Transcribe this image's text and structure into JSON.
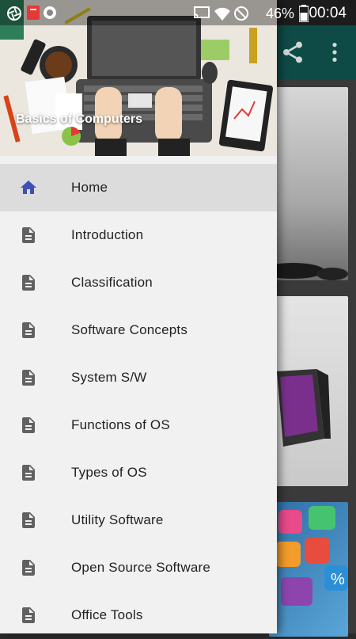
{
  "status_bar": {
    "battery_percent": "46%",
    "time": "00:04"
  },
  "drawer": {
    "header_title": "Basics of Computers",
    "items": [
      {
        "label": "Home",
        "icon": "home-icon",
        "active": true
      },
      {
        "label": "Introduction",
        "icon": "document-icon"
      },
      {
        "label": "Classification",
        "icon": "document-icon"
      },
      {
        "label": "Software Concepts",
        "icon": "document-icon"
      },
      {
        "label": "System S/W",
        "icon": "document-icon"
      },
      {
        "label": "Functions of OS",
        "icon": "document-icon"
      },
      {
        "label": "Types of OS",
        "icon": "document-icon"
      },
      {
        "label": "Utility Software",
        "icon": "document-icon"
      },
      {
        "label": "Open Source Software",
        "icon": "document-icon"
      },
      {
        "label": "Office Tools",
        "icon": "document-icon"
      }
    ]
  },
  "colors": {
    "toolbar": "#0e4a46",
    "home_icon": "#3f51b5",
    "doc_icon": "#616161",
    "active_row": "#dcdcdc"
  }
}
